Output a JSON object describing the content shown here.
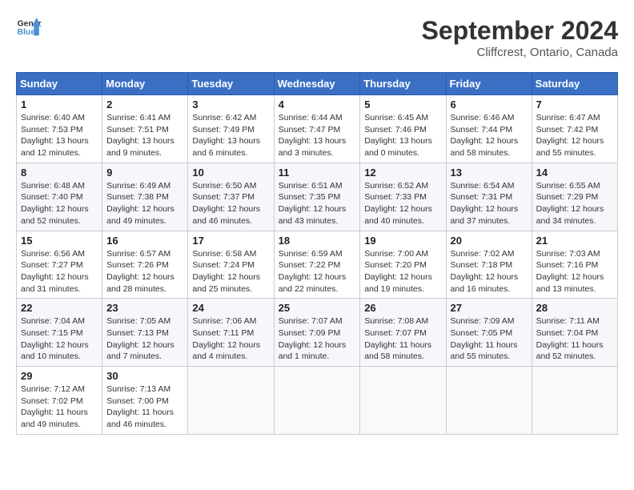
{
  "header": {
    "logo_line1": "General",
    "logo_line2": "Blue",
    "month": "September 2024",
    "location": "Cliffcrest, Ontario, Canada"
  },
  "days_of_week": [
    "Sunday",
    "Monday",
    "Tuesday",
    "Wednesday",
    "Thursday",
    "Friday",
    "Saturday"
  ],
  "weeks": [
    [
      {
        "day": "1",
        "sunrise": "Sunrise: 6:40 AM",
        "sunset": "Sunset: 7:53 PM",
        "daylight": "Daylight: 13 hours and 12 minutes."
      },
      {
        "day": "2",
        "sunrise": "Sunrise: 6:41 AM",
        "sunset": "Sunset: 7:51 PM",
        "daylight": "Daylight: 13 hours and 9 minutes."
      },
      {
        "day": "3",
        "sunrise": "Sunrise: 6:42 AM",
        "sunset": "Sunset: 7:49 PM",
        "daylight": "Daylight: 13 hours and 6 minutes."
      },
      {
        "day": "4",
        "sunrise": "Sunrise: 6:44 AM",
        "sunset": "Sunset: 7:47 PM",
        "daylight": "Daylight: 13 hours and 3 minutes."
      },
      {
        "day": "5",
        "sunrise": "Sunrise: 6:45 AM",
        "sunset": "Sunset: 7:46 PM",
        "daylight": "Daylight: 13 hours and 0 minutes."
      },
      {
        "day": "6",
        "sunrise": "Sunrise: 6:46 AM",
        "sunset": "Sunset: 7:44 PM",
        "daylight": "Daylight: 12 hours and 58 minutes."
      },
      {
        "day": "7",
        "sunrise": "Sunrise: 6:47 AM",
        "sunset": "Sunset: 7:42 PM",
        "daylight": "Daylight: 12 hours and 55 minutes."
      }
    ],
    [
      {
        "day": "8",
        "sunrise": "Sunrise: 6:48 AM",
        "sunset": "Sunset: 7:40 PM",
        "daylight": "Daylight: 12 hours and 52 minutes."
      },
      {
        "day": "9",
        "sunrise": "Sunrise: 6:49 AM",
        "sunset": "Sunset: 7:38 PM",
        "daylight": "Daylight: 12 hours and 49 minutes."
      },
      {
        "day": "10",
        "sunrise": "Sunrise: 6:50 AM",
        "sunset": "Sunset: 7:37 PM",
        "daylight": "Daylight: 12 hours and 46 minutes."
      },
      {
        "day": "11",
        "sunrise": "Sunrise: 6:51 AM",
        "sunset": "Sunset: 7:35 PM",
        "daylight": "Daylight: 12 hours and 43 minutes."
      },
      {
        "day": "12",
        "sunrise": "Sunrise: 6:52 AM",
        "sunset": "Sunset: 7:33 PM",
        "daylight": "Daylight: 12 hours and 40 minutes."
      },
      {
        "day": "13",
        "sunrise": "Sunrise: 6:54 AM",
        "sunset": "Sunset: 7:31 PM",
        "daylight": "Daylight: 12 hours and 37 minutes."
      },
      {
        "day": "14",
        "sunrise": "Sunrise: 6:55 AM",
        "sunset": "Sunset: 7:29 PM",
        "daylight": "Daylight: 12 hours and 34 minutes."
      }
    ],
    [
      {
        "day": "15",
        "sunrise": "Sunrise: 6:56 AM",
        "sunset": "Sunset: 7:27 PM",
        "daylight": "Daylight: 12 hours and 31 minutes."
      },
      {
        "day": "16",
        "sunrise": "Sunrise: 6:57 AM",
        "sunset": "Sunset: 7:26 PM",
        "daylight": "Daylight: 12 hours and 28 minutes."
      },
      {
        "day": "17",
        "sunrise": "Sunrise: 6:58 AM",
        "sunset": "Sunset: 7:24 PM",
        "daylight": "Daylight: 12 hours and 25 minutes."
      },
      {
        "day": "18",
        "sunrise": "Sunrise: 6:59 AM",
        "sunset": "Sunset: 7:22 PM",
        "daylight": "Daylight: 12 hours and 22 minutes."
      },
      {
        "day": "19",
        "sunrise": "Sunrise: 7:00 AM",
        "sunset": "Sunset: 7:20 PM",
        "daylight": "Daylight: 12 hours and 19 minutes."
      },
      {
        "day": "20",
        "sunrise": "Sunrise: 7:02 AM",
        "sunset": "Sunset: 7:18 PM",
        "daylight": "Daylight: 12 hours and 16 minutes."
      },
      {
        "day": "21",
        "sunrise": "Sunrise: 7:03 AM",
        "sunset": "Sunset: 7:16 PM",
        "daylight": "Daylight: 12 hours and 13 minutes."
      }
    ],
    [
      {
        "day": "22",
        "sunrise": "Sunrise: 7:04 AM",
        "sunset": "Sunset: 7:15 PM",
        "daylight": "Daylight: 12 hours and 10 minutes."
      },
      {
        "day": "23",
        "sunrise": "Sunrise: 7:05 AM",
        "sunset": "Sunset: 7:13 PM",
        "daylight": "Daylight: 12 hours and 7 minutes."
      },
      {
        "day": "24",
        "sunrise": "Sunrise: 7:06 AM",
        "sunset": "Sunset: 7:11 PM",
        "daylight": "Daylight: 12 hours and 4 minutes."
      },
      {
        "day": "25",
        "sunrise": "Sunrise: 7:07 AM",
        "sunset": "Sunset: 7:09 PM",
        "daylight": "Daylight: 12 hours and 1 minute."
      },
      {
        "day": "26",
        "sunrise": "Sunrise: 7:08 AM",
        "sunset": "Sunset: 7:07 PM",
        "daylight": "Daylight: 11 hours and 58 minutes."
      },
      {
        "day": "27",
        "sunrise": "Sunrise: 7:09 AM",
        "sunset": "Sunset: 7:05 PM",
        "daylight": "Daylight: 11 hours and 55 minutes."
      },
      {
        "day": "28",
        "sunrise": "Sunrise: 7:11 AM",
        "sunset": "Sunset: 7:04 PM",
        "daylight": "Daylight: 11 hours and 52 minutes."
      }
    ],
    [
      {
        "day": "29",
        "sunrise": "Sunrise: 7:12 AM",
        "sunset": "Sunset: 7:02 PM",
        "daylight": "Daylight: 11 hours and 49 minutes."
      },
      {
        "day": "30",
        "sunrise": "Sunrise: 7:13 AM",
        "sunset": "Sunset: 7:00 PM",
        "daylight": "Daylight: 11 hours and 46 minutes."
      },
      null,
      null,
      null,
      null,
      null
    ]
  ]
}
